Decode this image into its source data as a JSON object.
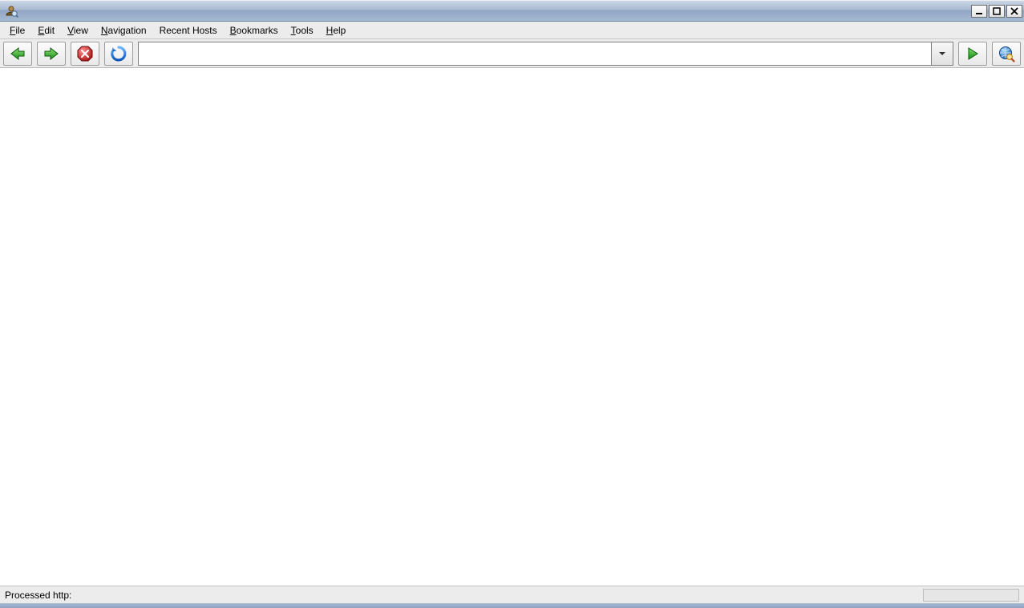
{
  "menubar": {
    "file": "File",
    "edit": "Edit",
    "view": "View",
    "navigation": "Navigation",
    "recent_hosts": "Recent Hosts",
    "bookmarks": "Bookmarks",
    "tools": "Tools",
    "help": "Help"
  },
  "toolbar": {
    "address_value": ""
  },
  "statusbar": {
    "text": "Processed http:"
  }
}
